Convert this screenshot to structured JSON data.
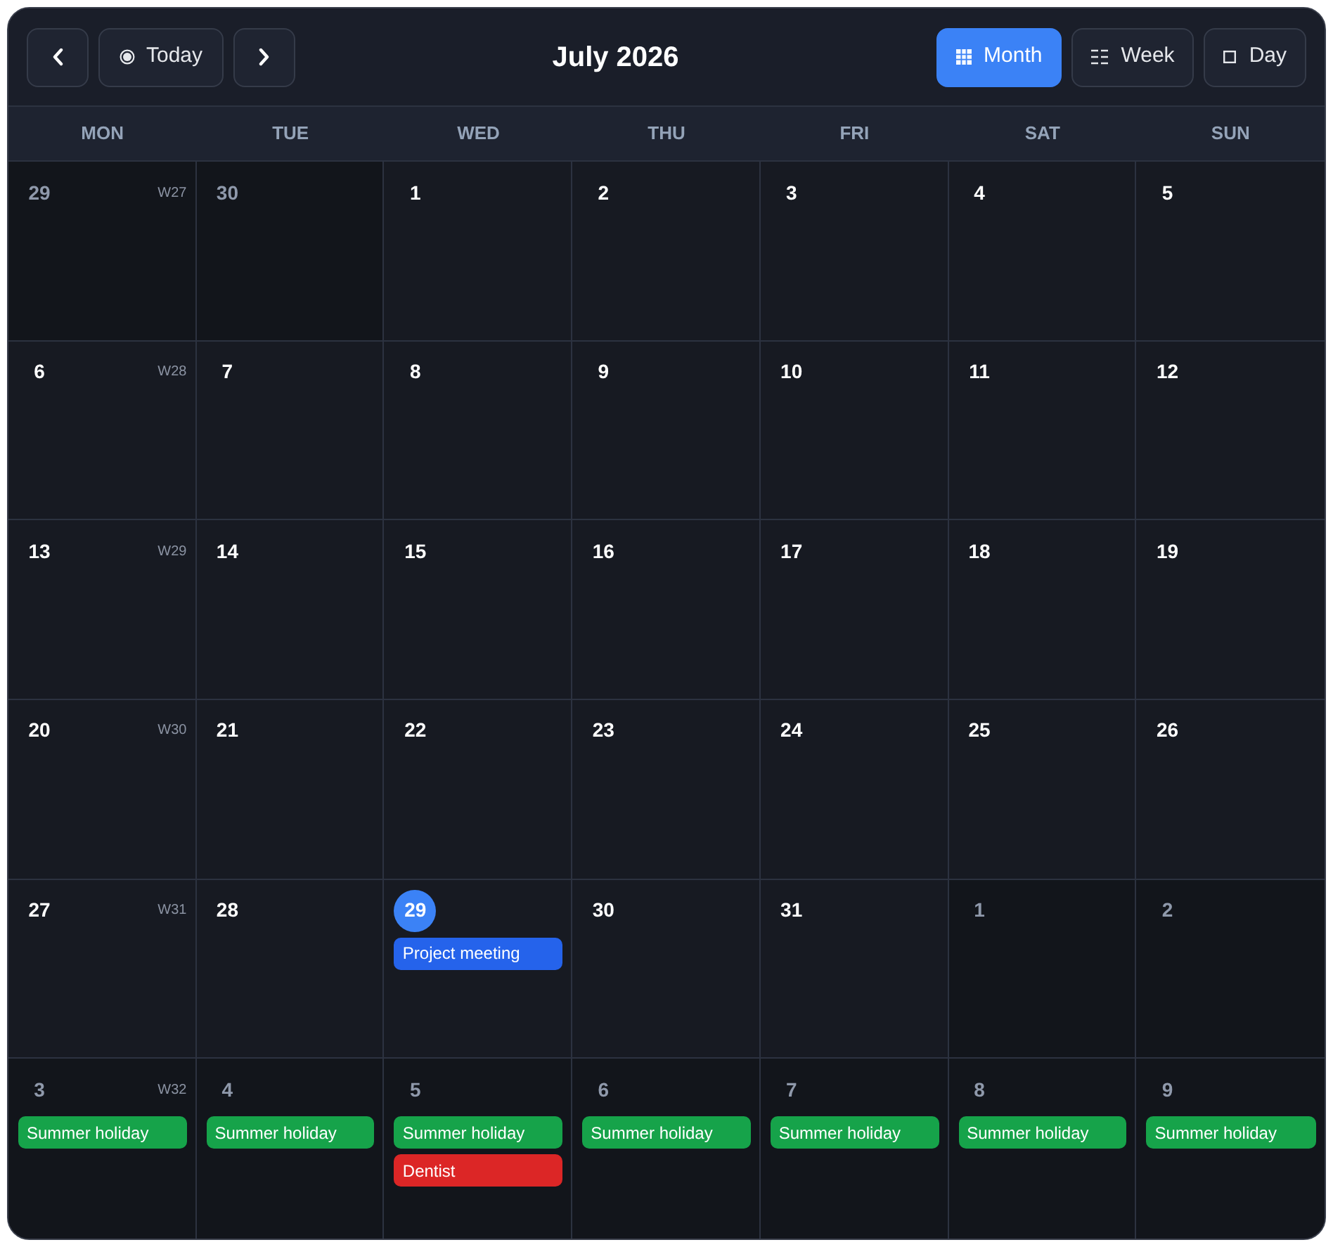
{
  "toolbar": {
    "today": "Today",
    "title": "July 2026",
    "views": [
      {
        "label": "Month",
        "kind": "month",
        "selected": true
      },
      {
        "label": "Week",
        "kind": "week",
        "selected": false
      },
      {
        "label": "Day",
        "kind": "day",
        "selected": false
      }
    ]
  },
  "weekdays": [
    "MON",
    "TUE",
    "WED",
    "THU",
    "FRI",
    "SAT",
    "SUN"
  ],
  "weeks": [
    {
      "week": "W27",
      "days": [
        {
          "day": "29",
          "outside_month": true,
          "today": false
        },
        {
          "day": "30",
          "outside_month": true,
          "today": false
        },
        {
          "day": "1",
          "outside_month": false,
          "today": false
        },
        {
          "day": "2",
          "outside_month": false,
          "today": false
        },
        {
          "day": "3",
          "outside_month": false,
          "today": false
        },
        {
          "day": "4",
          "outside_month": false,
          "today": false
        },
        {
          "day": "5",
          "outside_month": false,
          "today": false
        }
      ]
    },
    {
      "week": "W28",
      "days": [
        {
          "day": "6",
          "outside_month": false,
          "today": false
        },
        {
          "day": "7",
          "outside_month": false,
          "today": false
        },
        {
          "day": "8",
          "outside_month": false,
          "today": false
        },
        {
          "day": "9",
          "outside_month": false,
          "today": false
        },
        {
          "day": "10",
          "outside_month": false,
          "today": false
        },
        {
          "day": "11",
          "outside_month": false,
          "today": false
        },
        {
          "day": "12",
          "outside_month": false,
          "today": false
        }
      ]
    },
    {
      "week": "W29",
      "days": [
        {
          "day": "13",
          "outside_month": false,
          "today": false
        },
        {
          "day": "14",
          "outside_month": false,
          "today": false
        },
        {
          "day": "15",
          "outside_month": false,
          "today": false
        },
        {
          "day": "16",
          "outside_month": false,
          "today": false
        },
        {
          "day": "17",
          "outside_month": false,
          "today": false
        },
        {
          "day": "18",
          "outside_month": false,
          "today": false
        },
        {
          "day": "19",
          "outside_month": false,
          "today": false
        }
      ]
    },
    {
      "week": "W30",
      "days": [
        {
          "day": "20",
          "outside_month": false,
          "today": false
        },
        {
          "day": "21",
          "outside_month": false,
          "today": false
        },
        {
          "day": "22",
          "outside_month": false,
          "today": false
        },
        {
          "day": "23",
          "outside_month": false,
          "today": false
        },
        {
          "day": "24",
          "outside_month": false,
          "today": false
        },
        {
          "day": "25",
          "outside_month": false,
          "today": false
        },
        {
          "day": "26",
          "outside_month": false,
          "today": false
        }
      ]
    },
    {
      "week": "W31",
      "days": [
        {
          "day": "27",
          "outside_month": false,
          "today": false
        },
        {
          "day": "28",
          "outside_month": false,
          "today": false
        },
        {
          "day": "29",
          "outside_month": false,
          "today": true,
          "events": [
            {
              "title": "Project meeting",
              "color": "#2563eb"
            }
          ]
        },
        {
          "day": "30",
          "outside_month": false,
          "today": false
        },
        {
          "day": "31",
          "outside_month": false,
          "today": false
        },
        {
          "day": "1",
          "outside_month": true,
          "today": false
        },
        {
          "day": "2",
          "outside_month": true,
          "today": false
        }
      ]
    },
    {
      "week": "W32",
      "days": [
        {
          "day": "3",
          "outside_month": true,
          "today": false,
          "events": [
            {
              "title": "Summer holiday",
              "color": "#16a34a"
            }
          ]
        },
        {
          "day": "4",
          "outside_month": true,
          "today": false,
          "events": [
            {
              "title": "Summer holiday",
              "color": "#16a34a"
            }
          ]
        },
        {
          "day": "5",
          "outside_month": true,
          "today": false,
          "events": [
            {
              "title": "Summer holiday",
              "color": "#16a34a"
            },
            {
              "title": "Dentist",
              "color": "#dc2626"
            }
          ]
        },
        {
          "day": "6",
          "outside_month": true,
          "today": false,
          "events": [
            {
              "title": "Summer holiday",
              "color": "#16a34a"
            }
          ]
        },
        {
          "day": "7",
          "outside_month": true,
          "today": false,
          "events": [
            {
              "title": "Summer holiday",
              "color": "#16a34a"
            }
          ]
        },
        {
          "day": "8",
          "outside_month": true,
          "today": false,
          "events": [
            {
              "title": "Summer holiday",
              "color": "#16a34a"
            }
          ]
        },
        {
          "day": "9",
          "outside_month": true,
          "today": false,
          "events": [
            {
              "title": "Summer holiday",
              "color": "#16a34a"
            }
          ]
        }
      ]
    }
  ]
}
